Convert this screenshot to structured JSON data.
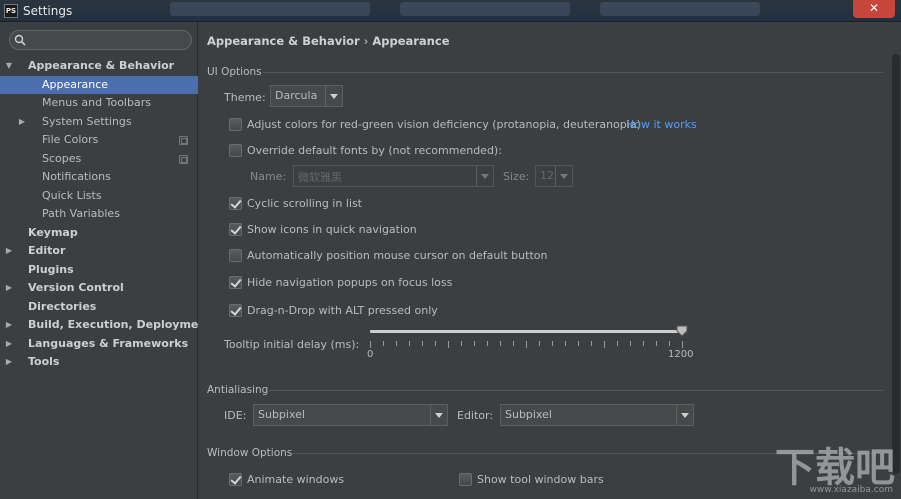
{
  "window": {
    "title": "Settings",
    "app_icon_text": "PS",
    "close_glyph": "✕"
  },
  "sidebar": {
    "search_icon": "search-icon",
    "search_placeholder": "",
    "items": [
      {
        "label": "Appearance & Behavior",
        "level": 0,
        "bold": true,
        "expanded": true,
        "expandable": true
      },
      {
        "label": "Appearance",
        "level": 1,
        "selected": true
      },
      {
        "label": "Menus and Toolbars",
        "level": 1
      },
      {
        "label": "System Settings",
        "level": 1,
        "expandable": true,
        "expanded": false
      },
      {
        "label": "File Colors",
        "level": 1,
        "project_icon": true
      },
      {
        "label": "Scopes",
        "level": 1,
        "project_icon": true
      },
      {
        "label": "Notifications",
        "level": 1
      },
      {
        "label": "Quick Lists",
        "level": 1
      },
      {
        "label": "Path Variables",
        "level": 1
      },
      {
        "label": "Keymap",
        "level": 0,
        "bold": true
      },
      {
        "label": "Editor",
        "level": 0,
        "bold": true,
        "expandable": true
      },
      {
        "label": "Plugins",
        "level": 0,
        "bold": true
      },
      {
        "label": "Version Control",
        "level": 0,
        "bold": true,
        "expandable": true
      },
      {
        "label": "Directories",
        "level": 0,
        "bold": true
      },
      {
        "label": "Build, Execution, Deployment",
        "level": 0,
        "bold": true,
        "expandable": true
      },
      {
        "label": "Languages & Frameworks",
        "level": 0,
        "bold": true,
        "expandable": true
      },
      {
        "label": "Tools",
        "level": 0,
        "bold": true,
        "expandable": true
      }
    ]
  },
  "breadcrumb": {
    "parent": "Appearance & Behavior",
    "separator": "›",
    "current": "Appearance"
  },
  "ui_options": {
    "section_title": "UI Options",
    "theme_label": "Theme:",
    "theme_value": "Darcula",
    "adjust_colors_label": "Adjust colors for red-green vision deficiency (protanopia, deuteranopia)",
    "adjust_colors_checked": false,
    "how_it_works_link": "How it works",
    "override_fonts_label": "Override default fonts by (not recommended):",
    "override_fonts_checked": false,
    "font_name_label": "Name:",
    "font_name_value": "微软雅黑",
    "font_size_label": "Size:",
    "font_size_value": "12",
    "cyclic_scrolling_label": "Cyclic scrolling in list",
    "cyclic_scrolling_checked": true,
    "show_icons_label": "Show icons in quick navigation",
    "show_icons_checked": true,
    "auto_mouse_label": "Automatically position mouse cursor on default button",
    "auto_mouse_checked": false,
    "hide_nav_label": "Hide navigation popups on focus loss",
    "hide_nav_checked": true,
    "drag_drop_label": "Drag-n-Drop with ALT pressed only",
    "drag_drop_checked": true,
    "tooltip_delay_label": "Tooltip initial delay (ms):",
    "tooltip_min": "0",
    "tooltip_max": "1200",
    "tooltip_value": 1200
  },
  "antialiasing": {
    "section_title": "Antialiasing",
    "ide_label": "IDE:",
    "ide_value": "Subpixel",
    "editor_label": "Editor:",
    "editor_value": "Subpixel"
  },
  "window_options": {
    "section_title": "Window Options",
    "animate_windows_label": "Animate windows",
    "animate_windows_checked": true,
    "show_tool_window_bars_label": "Show tool window bars",
    "show_tool_window_bars_checked": false
  },
  "watermark": {
    "text": "下载吧",
    "url": "www.xiazaiba.com"
  }
}
